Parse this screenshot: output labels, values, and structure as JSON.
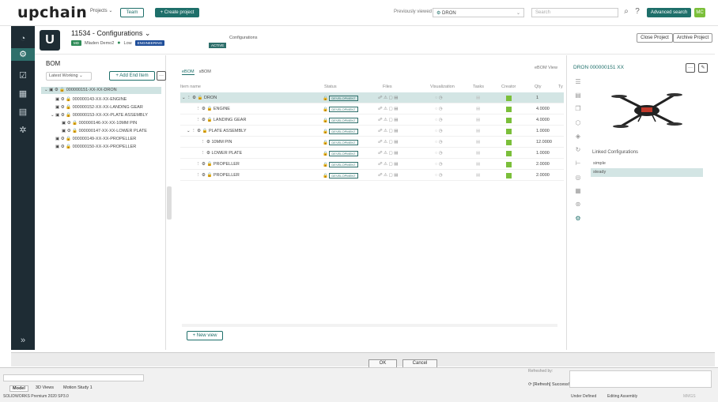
{
  "topbar": {
    "logo": "upchain",
    "nav_projects": "Projects ⌄",
    "team_button": "Team",
    "create_button": "+  Create project",
    "previously_viewed_label": "Previously viewed",
    "previously_viewed_value": "DRON",
    "search_placeholder": "Search",
    "advanced_search": "Advanced search",
    "avatar_initials": "MC"
  },
  "project": {
    "title": "11534 - Configurations",
    "title_chevron": "⌄",
    "owner_badge": "MD",
    "owner": "Mladen Demo2",
    "priority": "Low",
    "stage_tag": "ENGINEERING",
    "state_tag": "ACTIVE",
    "configurations_label": "Configurations",
    "close_button": "Close Project",
    "archive_button": "Archive Project"
  },
  "bom": {
    "title": "BOM",
    "select_value": "Latest Working",
    "add_end_item": "+  Add End Item",
    "more": "···",
    "tree": [
      {
        "label": "000000151-XX-XX-DRON",
        "selected": true
      },
      {
        "label": "000000143-XX-XX-ENGINE"
      },
      {
        "label": "000000152-XX-XX-LANDING GEAR"
      },
      {
        "label": "000000153-XX-XX-PLATE ASSEMBLY"
      },
      {
        "label": "000000146-XX-XX-10MM PIN"
      },
      {
        "label": "000000147-XX-XX-LOWER PLATE"
      },
      {
        "label": "000000149-XX-XX-PROPELLER"
      },
      {
        "label": "000000150-XX-XX-PROPELLER"
      }
    ]
  },
  "center": {
    "tabs": [
      "eBOM",
      "sBOM"
    ],
    "ebom_view": "eBOM View",
    "columns": {
      "item_name": "Item name",
      "status": "Status",
      "files": "Files",
      "visualization": "Visualization",
      "tasks": "Tasks",
      "creator": "Creator",
      "qty": "Qty",
      "ty": "Ty"
    },
    "rows": [
      {
        "name": "DRON",
        "status": "DEVELOPMENT",
        "qty": "1"
      },
      {
        "name": "ENGINE",
        "status": "DEVELOPMENT",
        "qty": "4.0000"
      },
      {
        "name": "LANDING GEAR",
        "status": "DEVELOPMENT",
        "qty": "4.0000"
      },
      {
        "name": "PLATE ASSEMBLY",
        "status": "DEVELOPMENT",
        "qty": "1.0000"
      },
      {
        "name": "10MM PIN",
        "status": "DEVELOPMENT",
        "qty": "12.0000"
      },
      {
        "name": "LOWER PLATE",
        "status": "DEVELOPMENT",
        "qty": "1.0000"
      },
      {
        "name": "PROPELLER",
        "status": "DEVELOPMENT",
        "qty": "2.0000"
      },
      {
        "name": "PROPELLER",
        "status": "DEVELOPMENT",
        "qty": "2.0000"
      }
    ],
    "new_view": "+  New view"
  },
  "right": {
    "title": "DRON 000000151 XX",
    "linked_label": "Linked Configurations",
    "linked": [
      "simple",
      "steady"
    ]
  },
  "dialog": {
    "ok": "OK",
    "cancel": "Cancel"
  },
  "solidworks": {
    "tabs": [
      "Model",
      "3D Views",
      "Motion Study 1"
    ],
    "version": "SOLIDWORKS Premium 2020 SP3.0",
    "refreshed_by": "Refreshed by:",
    "refresh_status": "[Refresh] Success!",
    "under_defined": "Under Defined",
    "editing": "Editing Assembly",
    "units": "MMGS"
  },
  "colors": {
    "brand": "#1e6f6a",
    "rail": "#1e2c34",
    "creator": "#7bbf3a"
  }
}
